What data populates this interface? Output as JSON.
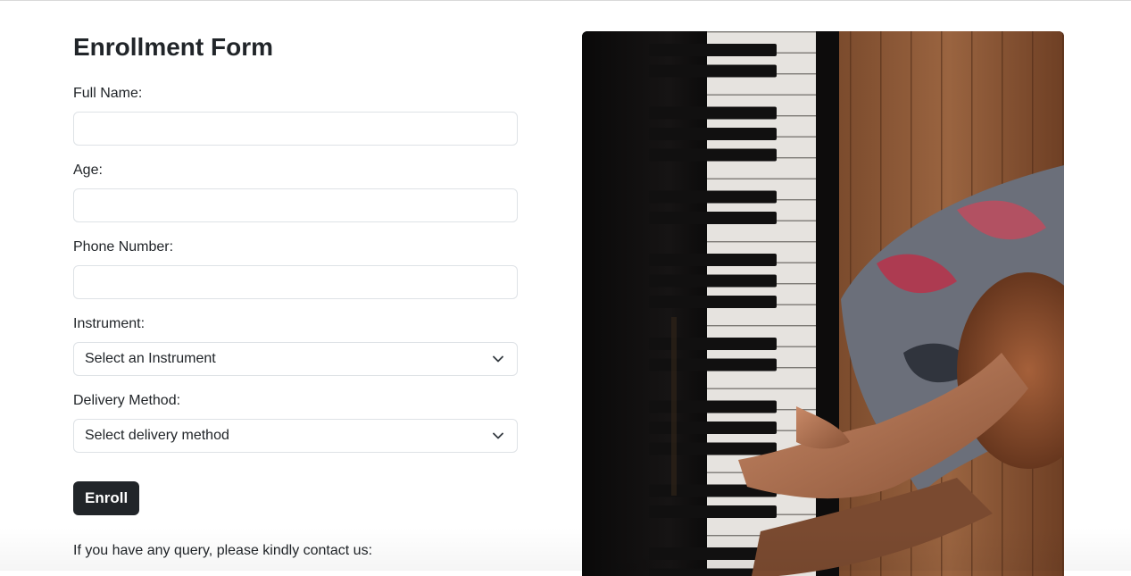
{
  "form": {
    "title": "Enrollment Form",
    "full_name": {
      "label": "Full Name:",
      "value": "",
      "placeholder": ""
    },
    "age": {
      "label": "Age:",
      "value": "",
      "placeholder": ""
    },
    "phone": {
      "label": "Phone Number:",
      "value": "",
      "placeholder": ""
    },
    "instrument": {
      "label": "Instrument:",
      "selected": "Select an Instrument"
    },
    "delivery": {
      "label": "Delivery Method:",
      "selected": "Select delivery method"
    },
    "submit_label": "Enroll",
    "contact_text": "If you have any query, please kindly contact us:"
  },
  "image": {
    "subject": "piano-player-photo"
  },
  "icons": {
    "dropdown": "chevron-down-icon"
  },
  "colors": {
    "button_bg": "#212529",
    "button_text": "#ffffff",
    "field_border": "#dee2e6",
    "text": "#212529"
  }
}
